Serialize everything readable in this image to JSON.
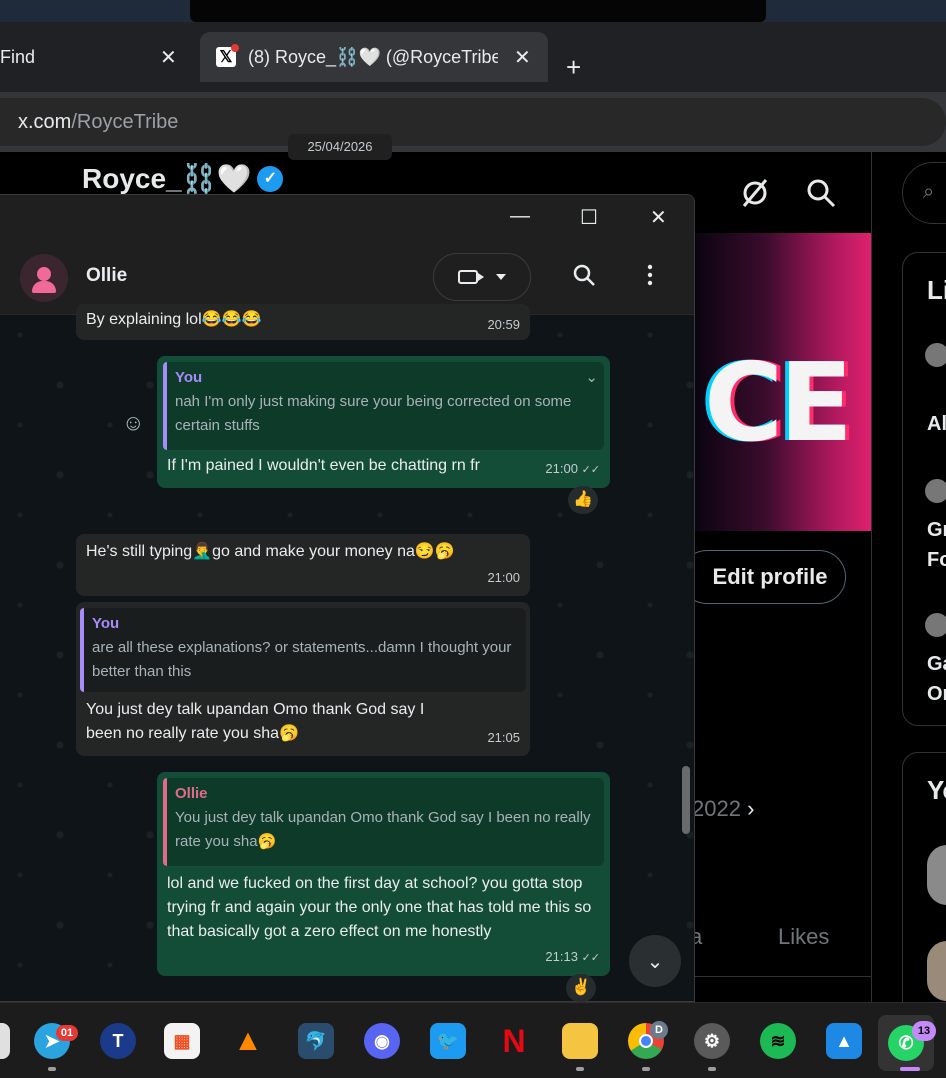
{
  "browser": {
    "tab_inactive_label": "Find",
    "tab_active_label": "(8) Royce_⛓️🤍 (@RoyceTribe)",
    "tab_close_glyph": "✕",
    "new_tab_glyph": "+",
    "url_host": "x.com",
    "url_path": "/RoyceTribe"
  },
  "x_profile": {
    "display_name": "Royce_⛓️🤍",
    "verified_glyph": "✓",
    "back_glyph": "←",
    "banner_text": "CE",
    "edit_profile_label": "Edit profile",
    "joined_partial": "2022",
    "tab_partial": "a",
    "likes_tab_label": "Likes",
    "panel1_heading": "Li",
    "panel1_items": [
      "Al",
      "Gr",
      "Fo",
      "Ga",
      "Or"
    ],
    "panel2_heading": "Yo"
  },
  "whatsapp": {
    "contact_name": "Ollie",
    "title_controls": [
      "—",
      "☐",
      "✕"
    ],
    "date_chip": "25/04/2026",
    "messages": [
      {
        "dir": "in",
        "text": "By explaining lol😂😂😂",
        "time": "20:59"
      },
      {
        "dir": "out",
        "quote_author": "You",
        "quote_text": "nah I'm only just making sure your being corrected on some certain stuffs",
        "text": "If I'm pained I wouldn't even be chatting rn fr",
        "time": "21:00",
        "ticks": "✓✓",
        "reaction": "👍"
      },
      {
        "dir": "in",
        "text": "He's still typing🤦‍♂️go and make your money na😏🥱",
        "time": "21:00"
      },
      {
        "dir": "in",
        "quote_author": "You",
        "quote_text": "are all these explanations? or statements...damn I thought your better than this",
        "text": "You just dey talk upandan Omo thank God say I been no really rate you sha🥱",
        "time": "21:05"
      },
      {
        "dir": "out",
        "quote_author": "Ollie",
        "quote_text": "You just dey talk upandan Omo thank God say I been no really rate you sha🥱",
        "text": "lol and we fucked on the first day at school? you gotta stop trying fr and again your the only one that has told me this so that basically got a zero effect on me honestly",
        "time": "21:13",
        "ticks": "✓✓",
        "reaction": "✌️"
      }
    ]
  },
  "taskbar": {
    "telegram_badge": "01",
    "chrome_badge": "D",
    "whatsapp_badge": "13",
    "apps": [
      "telegram",
      "trust-wallet",
      "microsoft-store",
      "vlc",
      "mysql-workbench",
      "discord",
      "twitter",
      "netflix",
      "file-explorer",
      "chrome",
      "settings",
      "spotify",
      "photos",
      "whatsapp"
    ]
  },
  "colors": {
    "wa_outgoing": "#144d37",
    "wa_incoming": "#242626",
    "x_verified": "#1d9bf0",
    "quote_you": "#a78bfa",
    "quote_ollie": "#e06c8a"
  }
}
